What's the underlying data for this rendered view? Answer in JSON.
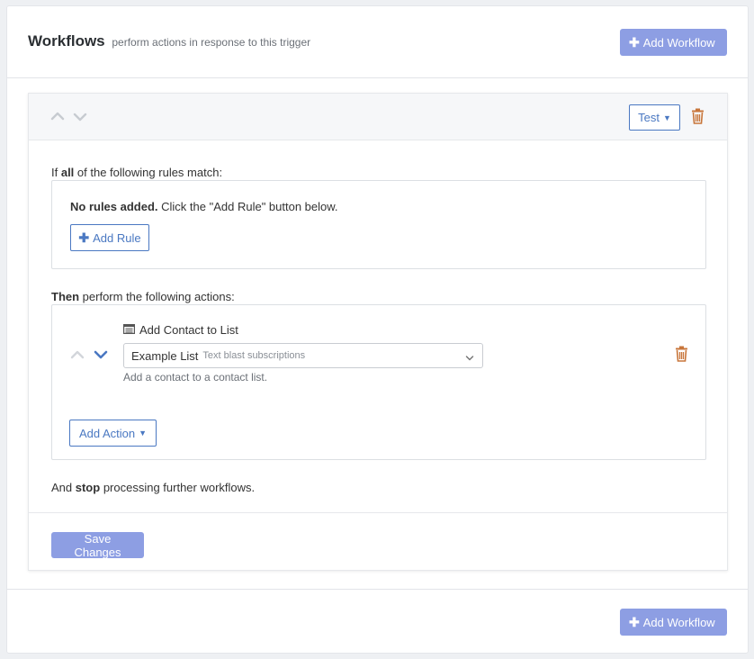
{
  "header": {
    "title": "Workflows",
    "subtitle": "perform actions in response to this trigger",
    "add_workflow_label": "Add Workflow"
  },
  "card": {
    "test_label": "Test",
    "rules": {
      "prefix": "If ",
      "quantifier": "all",
      "suffix": " of the following rules match:",
      "empty_bold": "No rules added.",
      "empty_text": " Click the \"Add Rule\" button below.",
      "add_rule_label": "Add Rule"
    },
    "actions": {
      "prefix_bold": "Then",
      "suffix": " perform the following actions:",
      "items": [
        {
          "title": "Add Contact to List",
          "icon": "list-icon",
          "select_value": "Example List",
          "select_detail": "Text blast subscriptions",
          "help": "Add a contact to a contact list."
        }
      ],
      "add_action_label": "Add Action"
    },
    "stop": {
      "prefix": "And ",
      "bold": "stop",
      "suffix": " processing further workflows."
    },
    "save_label": "Save Changes"
  },
  "footer": {
    "add_workflow_label": "Add Workflow"
  },
  "colors": {
    "primary_button": "#8d9ee3",
    "outline_accent": "#4a78c2",
    "trash": "#c8763b",
    "chevron_active": "#4a78c2",
    "chevron_inactive": "#c7cbd1"
  }
}
